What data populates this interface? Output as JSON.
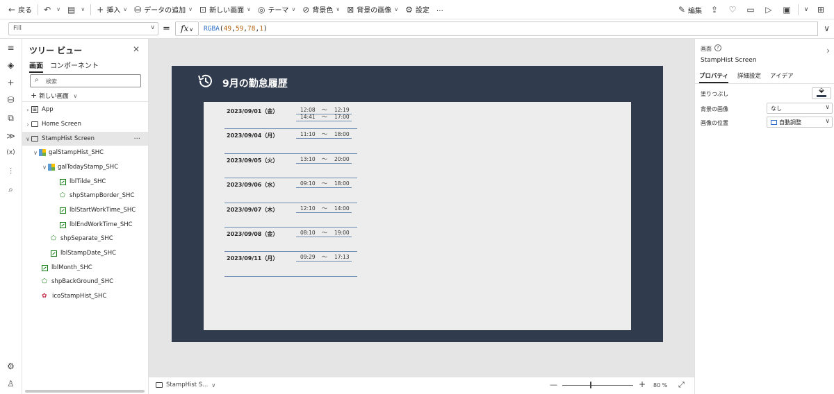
{
  "toolbar": {
    "back": "戻る",
    "insert": "挿入",
    "add_data": "データの追加",
    "new_screen": "新しい画面",
    "theme": "テーマ",
    "bg_color": "背景色",
    "bg_image": "背景の画像",
    "settings": "設定",
    "more": "…",
    "edit": "編集"
  },
  "formula_bar": {
    "property": "Fill",
    "equals": "=",
    "fx": "fx",
    "fn": "RGBA",
    "args": [
      "49",
      "59",
      "78",
      "1"
    ]
  },
  "tree": {
    "title": "ツリー ビュー",
    "tabs": [
      "画面",
      "コンポーネント"
    ],
    "search_placeholder": "検索",
    "new_screen": "新しい画面",
    "items": [
      {
        "label": "App",
        "type": "app"
      },
      {
        "label": "Home Screen",
        "type": "screen"
      },
      {
        "label": "StampHist Screen",
        "type": "screen",
        "selected": true
      },
      {
        "label": "galStampHist_SHC",
        "type": "gallery"
      },
      {
        "label": "galTodayStamp_SHC",
        "type": "gallery"
      },
      {
        "label": "lblTilde_SHC",
        "type": "label"
      },
      {
        "label": "shpStampBorder_SHC",
        "type": "shape"
      },
      {
        "label": "lblStartWorkTime_SHC",
        "type": "label"
      },
      {
        "label": "lblEndWorkTime_SHC",
        "type": "label"
      },
      {
        "label": "shpSeparate_SHC",
        "type": "shape"
      },
      {
        "label": "lblStampDate_SHC",
        "type": "label"
      },
      {
        "label": "lblMonth_SHC",
        "type": "label"
      },
      {
        "label": "shpBackGround_SHC",
        "type": "shape"
      },
      {
        "label": "icoStampHist_SHC",
        "type": "icon"
      }
    ]
  },
  "canvas": {
    "title": "9月の勤怠履歴",
    "background_color": "#313b4e",
    "tilde": "～",
    "rows": [
      {
        "date": "2023/09/01（金）",
        "stamps": [
          {
            "start": "12:08",
            "end": "12:19"
          },
          {
            "start": "14:41",
            "end": "17:00"
          }
        ]
      },
      {
        "date": "2023/09/04（月）",
        "stamps": [
          {
            "start": "11:10",
            "end": "18:00"
          }
        ]
      },
      {
        "date": "2023/09/05（火）",
        "stamps": [
          {
            "start": "13:10",
            "end": "20:00"
          }
        ]
      },
      {
        "date": "2023/09/06（水）",
        "stamps": [
          {
            "start": "09:10",
            "end": "18:00"
          }
        ]
      },
      {
        "date": "2023/09/07（木）",
        "stamps": [
          {
            "start": "12:10",
            "end": "14:00"
          }
        ]
      },
      {
        "date": "2023/09/08（金）",
        "stamps": [
          {
            "start": "08:10",
            "end": "19:00"
          }
        ]
      },
      {
        "date": "2023/09/11（月）",
        "stamps": [
          {
            "start": "09:29",
            "end": "17:13"
          }
        ]
      }
    ]
  },
  "statusbar": {
    "screen": "StampHist S...",
    "zoom_minus": "—",
    "zoom_plus": "+",
    "zoom_level": 80,
    "zoom_pct": "80 %"
  },
  "props": {
    "kind": "画面",
    "name": "StampHist Screen",
    "tabs": [
      "プロパティ",
      "詳細設定",
      "アイデア"
    ],
    "fill_label": "塗りつぶし",
    "fill_color": "#313b4e",
    "bg_image_label": "背景の画像",
    "bg_image_value": "なし",
    "image_position_label": "画像の位置",
    "image_position_value": "自動調整"
  }
}
